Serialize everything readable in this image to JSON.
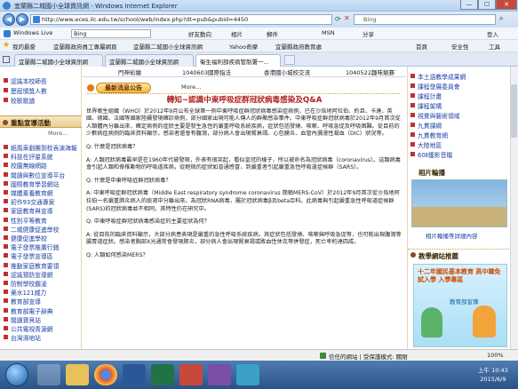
{
  "window": {
    "title": "宜蘭縣二城國小全球資訊網 - Windows Internet Explorer",
    "min_label": "—",
    "max_label": "☐",
    "close_label": "✕"
  },
  "address": {
    "url": "http://www.eces.ilc.edu.tw/school/web/index.php?dt=pub&pubid=4450",
    "search_placeholder": "Bing"
  },
  "toolbar1": {
    "brand": "Windows Live",
    "search": "Bing",
    "items": [
      "好友動向",
      "相片",
      "郵件",
      "MSN",
      "分享"
    ],
    "signin": "登入"
  },
  "favorites": {
    "label": "我的最愛",
    "items": [
      "宜蘭縣政府員工專屬網頁",
      "宜蘭縣二城國小全球資訊網",
      "Yahoo奇摩",
      "宜蘭縣政府教育處"
    ],
    "tools": [
      "首頁",
      "安全性",
      "工具"
    ]
  },
  "tabs": [
    {
      "label": "宜蘭縣二城國小全球資訊網"
    },
    {
      "label": "宜蘭縣二城國小全球資訊網"
    },
    {
      "label": "衛生福利部疾病管制署一..."
    }
  ],
  "left": {
    "top_links": [
      "認識本校師長",
      "歷屆頒獎人數",
      "校歌歌譜"
    ],
    "section_title": "重點宣導活動",
    "more_label": "More...",
    "links": [
      "紙風車劇團到校表演海報",
      "科技在評量系統",
      "校園無線網路",
      "閱讀與數位宣導平台",
      "國際教育學習網站",
      "媒體素養教育網",
      "初作93交通專案",
      "家庭教育與宣導",
      "性別平等教育",
      "二城健康促進學校",
      "健康促進學校",
      "電子發票推廣行銷",
      "電子發票宣導區",
      "推動家庭教育要領",
      "認識預防宣導網",
      "防制學校霸凌",
      "藥水121威力",
      "教育部宣導",
      "教育部電子辭典",
      "閱讀寶貝站",
      "公共電視青源網",
      "台灣濕地站"
    ]
  },
  "center": {
    "top_items": [
      "門神彩繪",
      "1040603國際指法",
      "香港國小城校交流",
      "1040522趣味競賽"
    ],
    "news_button": "最新消息公告",
    "more_label": "More...",
    "article_title": "轉知~認識中東呼吸症群冠狀病毒感染及Q&A",
    "paragraphs": [
      "世界衛生組織（WHO）於2012年9月公布全球第一例中東呼吸症群冠狀病毒感染症病例，已在沙烏地阿拉伯、約旦、卡達、英國、德國、法國等國家陸續發現確診病例，部分國家出現可能人傳人的群聚感染事件。中東呼吸症群冠狀病毒於2012年9月首次從人類體內分離出來，確定病例的症狀主要是發生急性的嚴重呼吸系統疾病，症狀包括發燒、咳嗽、呼吸急促及呼吸困難。從目前的少數病症病例的臨床資料顯示，感染者還會有腹瀉，部分病人會出現腎衰竭、心包膜炎、血管內瀰漫性凝血（DIC）狀況等。",
      "Q: 什麼是冠狀病毒？",
      "A: 人類冠狀病毒最早是在1960年代被發現，外表有很突起，看似皇冠的樣子，所以被命名為冠狀病毒（coronavirus）。這類病毒會引起人類和脊椎動物的呼吸道疾病，從輕微的症狀如普通感冒，到嚴重者引起嚴重急性呼吸道症候群（SARS）。",
      "Q: 什麼是中東呼吸症群冠狀病毒？",
      "A: 中東呼吸症群冠狀病毒（Middle East respiratory syndrome coronavirus 簡稱MERS-CoV）於2012年9月首次從沙烏地阿拉伯一名嚴重肺炎病人的痰液中分離出來。為冠狀RNA病毒，屬於冠狀病毒β及beta亞科。此病毒與引起嚴重急性呼吸道症候群(SARS)的冠狀病毒並不相同，其特性仍在研究中。",
      "Q: 中東呼吸症群冠狀病毒感染症的主要症狀為何？",
      "A: 從目前的臨床資料顯示，大部分病患表現是嚴重的急性呼吸系統疾病，其症狀包括發燒、咳嗽與呼吸急促等，也可能出現腹瀉等腸胃道症狀。感染者胸部X光通常會發現肺炎，部分病人會出現腎衰竭或敗血性休克等併發症，死亡率約達四成。",
      "Q: 人類如何感染MERS？"
    ]
  },
  "right": {
    "links": [
      "本土語教學成果網",
      "課程發展委員會",
      "課程計畫",
      "課程架構",
      "視覺與藝術領域",
      "九貫課綱",
      "九貫教育網",
      "大陸地區",
      "60Ⅱ獲影音檔"
    ],
    "photo_title": "相片輪播",
    "photo_caption": "相片輪播等詳細內容",
    "section_title": "教學網站推薦",
    "promo_text": "十二年國民基本教育 高中職免試入學 入學專區",
    "promo_sub": "教育部宣導"
  },
  "status": {
    "zone": "信任的網站 | 受保護模式: 關閉",
    "zoom": "100%"
  },
  "taskbar": {
    "time": "上午 10:43",
    "date": "2015/6/9"
  }
}
